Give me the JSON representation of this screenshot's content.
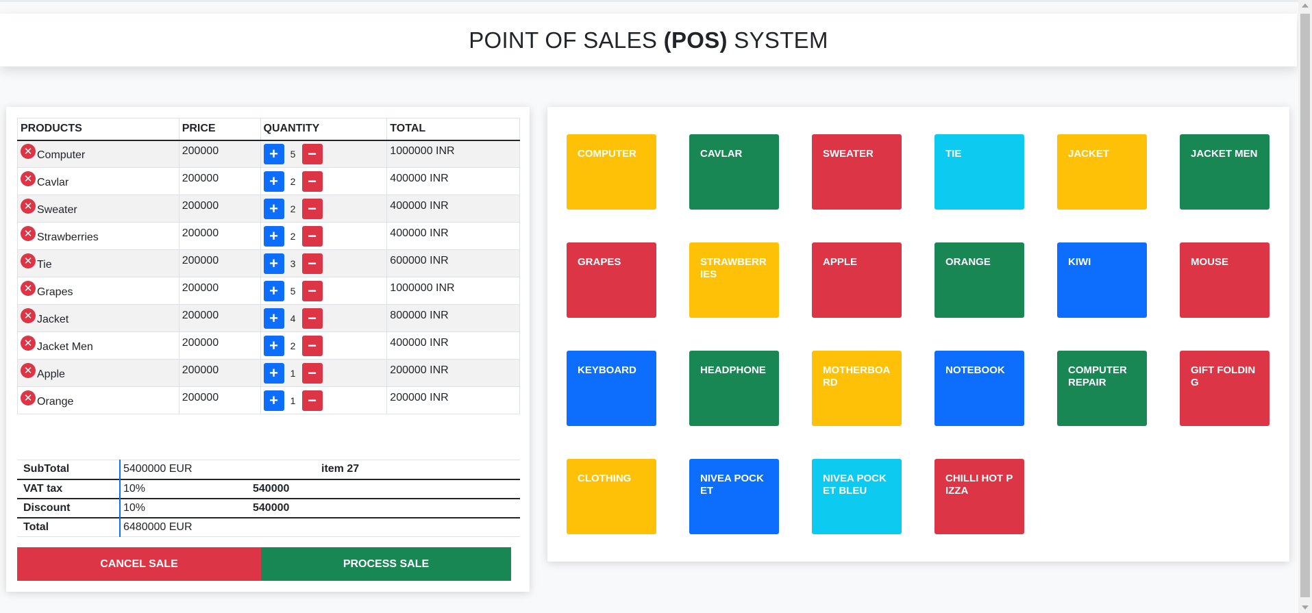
{
  "header": {
    "title_prefix": "POINT OF SALES ",
    "title_bold": "(POS)",
    "title_suffix": " SYSTEM"
  },
  "cart": {
    "headers": [
      "PRODUCTS",
      "PRICE",
      "QUANTITY",
      "TOTAL"
    ],
    "rows": [
      {
        "product": "Computer",
        "price": "200000",
        "qty": "5",
        "total": "1000000 INR"
      },
      {
        "product": "Cavlar",
        "price": "200000",
        "qty": "2",
        "total": "400000 INR"
      },
      {
        "product": "Sweater",
        "price": "200000",
        "qty": "2",
        "total": "400000 INR"
      },
      {
        "product": "Strawberries",
        "price": "200000",
        "qty": "2",
        "total": "400000 INR"
      },
      {
        "product": "Tie",
        "price": "200000",
        "qty": "3",
        "total": "600000 INR"
      },
      {
        "product": "Grapes",
        "price": "200000",
        "qty": "5",
        "total": "1000000 INR"
      },
      {
        "product": "Jacket",
        "price": "200000",
        "qty": "4",
        "total": "800000 INR"
      },
      {
        "product": "Jacket Men",
        "price": "200000",
        "qty": "2",
        "total": "400000 INR"
      },
      {
        "product": "Apple",
        "price": "200000",
        "qty": "1",
        "total": "200000 INR"
      },
      {
        "product": "Orange",
        "price": "200000",
        "qty": "1",
        "total": "200000 INR"
      }
    ],
    "remove_glyph": "✕",
    "plus_glyph": "+",
    "minus_glyph": "−"
  },
  "summary": {
    "subtotal_label": "SubTotal",
    "subtotal_value": "5400000 EUR",
    "items_label": "item 27",
    "vat_label": "VAT tax",
    "vat_value": "10%",
    "vat_amount": "540000",
    "discount_label": "Discount",
    "discount_value": "10%",
    "discount_amount": "540000",
    "total_label": "Total",
    "total_value": "6480000 EUR"
  },
  "actions": {
    "cancel_label": "CANCEL SALE",
    "process_label": "PROCESS SALE"
  },
  "products": [
    {
      "label": "COMPUTER",
      "color": "warning"
    },
    {
      "label": "CAVLAR",
      "color": "success"
    },
    {
      "label": "SWEATER",
      "color": "danger"
    },
    {
      "label": "TIE",
      "color": "info"
    },
    {
      "label": "JACKET",
      "color": "warning"
    },
    {
      "label": "JACKET MEN",
      "color": "success"
    },
    {
      "label": "GRAPES",
      "color": "danger"
    },
    {
      "label": "STRAWBERRIES",
      "color": "warning"
    },
    {
      "label": "APPLE",
      "color": "danger"
    },
    {
      "label": "ORANGE",
      "color": "success"
    },
    {
      "label": "KIWI",
      "color": "primary"
    },
    {
      "label": "MOUSE",
      "color": "danger"
    },
    {
      "label": "KEYBOARD",
      "color": "primary"
    },
    {
      "label": "HEADPHONE",
      "color": "success"
    },
    {
      "label": "MOTHERBOARD",
      "color": "warning"
    },
    {
      "label": "NOTEBOOK",
      "color": "primary"
    },
    {
      "label": "COMPUTER REPAIR",
      "color": "success"
    },
    {
      "label": "GIFT FOLDING",
      "color": "danger"
    },
    {
      "label": "CLOTHING",
      "color": "warning"
    },
    {
      "label": "NIVEA POCKET",
      "color": "primary"
    },
    {
      "label": "NIVEA POCKET BLEU",
      "color": "info"
    },
    {
      "label": "CHILLI HOT PIZZA",
      "color": "danger"
    }
  ],
  "colors": {
    "warning": "#ffc107",
    "success": "#198754",
    "danger": "#dc3545",
    "info": "#0dcaf0",
    "primary": "#0d6efd"
  }
}
